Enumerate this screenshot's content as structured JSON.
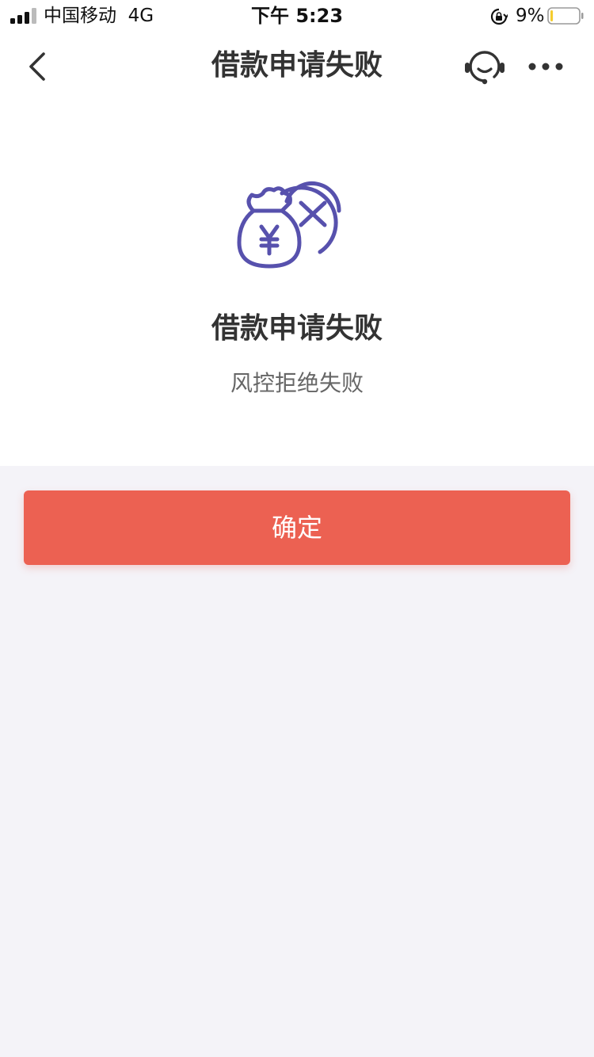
{
  "status_bar": {
    "carrier": "中国移动",
    "network": "4G",
    "time": "下午 5:23",
    "battery_percent": "9%",
    "battery_level": 0.09
  },
  "nav": {
    "title": "借款申请失败",
    "back_icon": "chevron-left-icon",
    "service_icon": "customer-service-icon",
    "more_icon": "more-dots-icon"
  },
  "result": {
    "icon": "money-bag-failed-icon",
    "title": "借款申请失败",
    "reason": "风控拒绝失败"
  },
  "actions": {
    "confirm_label": "确定"
  },
  "colors": {
    "accent": "#ec6152",
    "icon": "#5751ad",
    "background": "#f4f3f8",
    "battery_low": "#f5cc2e"
  }
}
